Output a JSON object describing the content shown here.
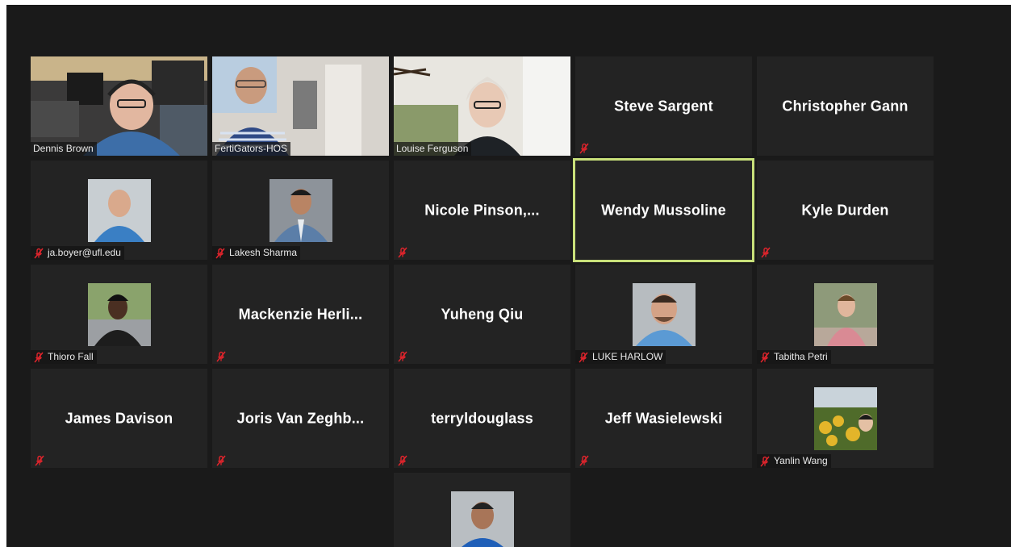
{
  "meeting": {
    "participants": [
      {
        "label": "Dennis Brown"
      },
      {
        "label": "FertiGators-HOS"
      },
      {
        "label": "Louise Ferguson"
      },
      {
        "name": "Steve Sargent"
      },
      {
        "name": "Christopher Gann"
      },
      {
        "label": "ja.boyer@ufl.edu"
      },
      {
        "label": "Lakesh Sharma"
      },
      {
        "name": "Nicole  Pinson,..."
      },
      {
        "name": "Wendy Mussoline"
      },
      {
        "name": "Kyle Durden"
      },
      {
        "label": "Thioro Fall"
      },
      {
        "name": "Mackenzie  Herli..."
      },
      {
        "name": "Yuheng Qiu"
      },
      {
        "label": "LUKE HARLOW"
      },
      {
        "label": "Tabitha Petri"
      },
      {
        "name": "James Davison"
      },
      {
        "name": "Joris Van Zeghb..."
      },
      {
        "name": "terryldouglass"
      },
      {
        "name": "Jeff Wasielewski"
      },
      {
        "label": "Yanlin Wang"
      }
    ]
  },
  "colors": {
    "active_speaker_border": "#c8e07a",
    "mute_icon": "#e0242c",
    "tile_bg": "#232323"
  }
}
